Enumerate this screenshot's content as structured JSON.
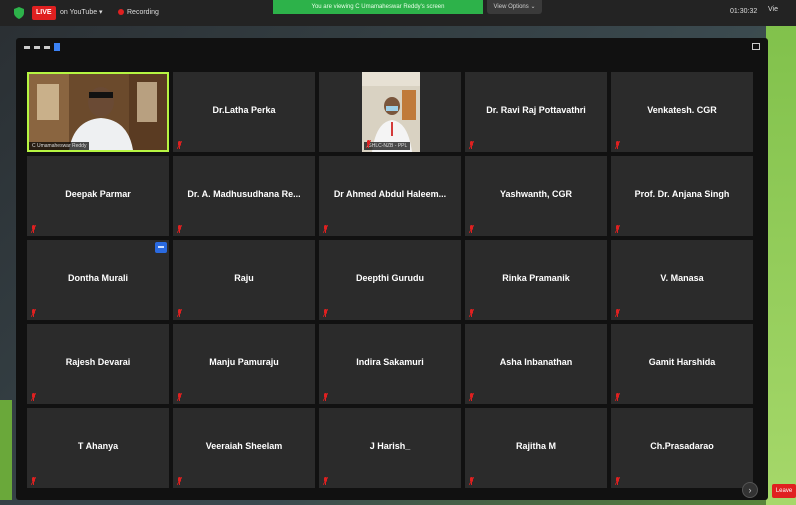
{
  "topbar": {
    "live_label": "LIVE",
    "youtube_label": "on YouTube ▾",
    "recording_label": "Recording",
    "sharing_banner": "You are viewing C Umamaheswar Reddy's screen",
    "view_options_label": "View Options ⌄",
    "clock": "01:30:32",
    "view_label": "Vie"
  },
  "participants": [
    {
      "name": "C Umamaheswar Reddy",
      "video": true
    },
    {
      "name": "Dr.Latha Perka"
    },
    {
      "name": "ISHLC-NZB - PPL",
      "video": true
    },
    {
      "name": "Dr. Ravi Raj Pottavathri"
    },
    {
      "name": "Venkatesh. CGR"
    },
    {
      "name": "Deepak Parmar"
    },
    {
      "name": "Dr. A. Madhusudhana Re..."
    },
    {
      "name": "Dr Ahmed Abdul Haleem..."
    },
    {
      "name": "Yashwanth, CGR"
    },
    {
      "name": "Prof. Dr. Anjana Singh"
    },
    {
      "name": "Dontha Murali"
    },
    {
      "name": "Raju"
    },
    {
      "name": "Deepthi Gurudu"
    },
    {
      "name": "Rinka Pramanik"
    },
    {
      "name": "V. Manasa"
    },
    {
      "name": "Rajesh Devarai"
    },
    {
      "name": "Manju Pamuraju"
    },
    {
      "name": "Indira Sakamuri"
    },
    {
      "name": "Asha Inbanathan"
    },
    {
      "name": "Gamit Harshida"
    },
    {
      "name": "T Ahanya"
    },
    {
      "name": "Veeraiah Sheelam"
    },
    {
      "name": "J Harish_"
    },
    {
      "name": "Rajitha M"
    },
    {
      "name": "Ch.Prasadarao"
    }
  ],
  "footer": {
    "leave_label": "Leave"
  },
  "colors": {
    "active_speaker": "#b6f542",
    "live_red": "#e02020",
    "share_green": "#2db24a",
    "tile_bg": "#2b2b2b"
  }
}
